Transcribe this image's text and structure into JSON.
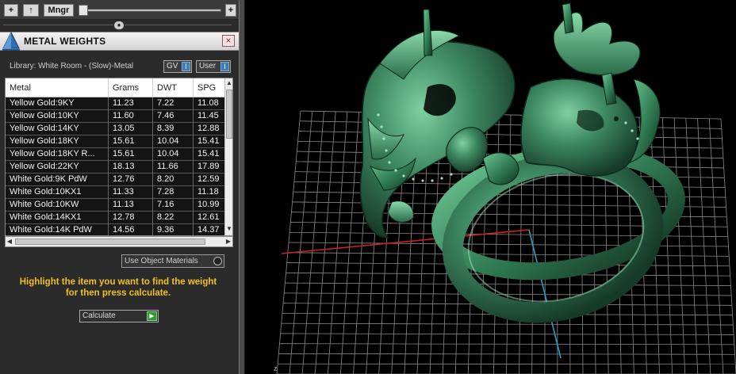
{
  "toolbar": {
    "add_label": "+",
    "up_label": "↑",
    "manager_label": "Mngr",
    "plus_label": "+",
    "knob_label": "●"
  },
  "window": {
    "title": "METAL WEIGHTS",
    "close_label": "×",
    "library_text": "Library: White Room - (Slow)-Metal",
    "gv_label": "GV",
    "user_label": "User",
    "toggle_glyph": "I"
  },
  "table": {
    "columns": [
      "Metal",
      "Grams",
      "DWT",
      "SPG"
    ],
    "rows": [
      [
        "Yellow Gold:9KY",
        "11.23",
        "7.22",
        "11.08"
      ],
      [
        "Yellow Gold:10KY",
        "11.60",
        "7.46",
        "11.45"
      ],
      [
        "Yellow Gold:14KY",
        "13.05",
        "8.39",
        "12.88"
      ],
      [
        "Yellow Gold:18KY",
        "15.61",
        "10.04",
        "15.41"
      ],
      [
        "Yellow Gold:18KY R...",
        "15.61",
        "10.04",
        "15.41"
      ],
      [
        "Yellow Gold:22KY",
        "18.13",
        "11.66",
        "17.89"
      ],
      [
        "White Gold:9K PdW",
        "12.76",
        "8.20",
        "12.59"
      ],
      [
        "White Gold:10KX1",
        "11.33",
        "7.28",
        "11.18"
      ],
      [
        "White Gold:10KW",
        "11.13",
        "7.16",
        "10.99"
      ],
      [
        "White Gold:14KX1",
        "12.78",
        "8.22",
        "12.61"
      ],
      [
        "White Gold:14K PdW",
        "14.56",
        "9.36",
        "14.37"
      ]
    ],
    "scroll_up": "▲",
    "scroll_down": "▼",
    "scroll_left": "◀",
    "scroll_right": "▶"
  },
  "options": {
    "use_object_materials": "Use Object Materials"
  },
  "instructions": {
    "line1": "Highlight the item you want to find the weight",
    "line2": "for then press calculate."
  },
  "actions": {
    "calculate_label": "Calculate",
    "go_glyph": "▶"
  },
  "viewport": {
    "axis_label": "z"
  },
  "colors": {
    "panel_bg": "#2b2b2b",
    "accent_yellow": "#f0c020",
    "ring_green": "#3e8a63",
    "grid_line": "#8a8a8a"
  },
  "icons": {
    "title_logo": "pyramid-logo-icon",
    "close": "close-icon",
    "calculate": "play-icon"
  }
}
